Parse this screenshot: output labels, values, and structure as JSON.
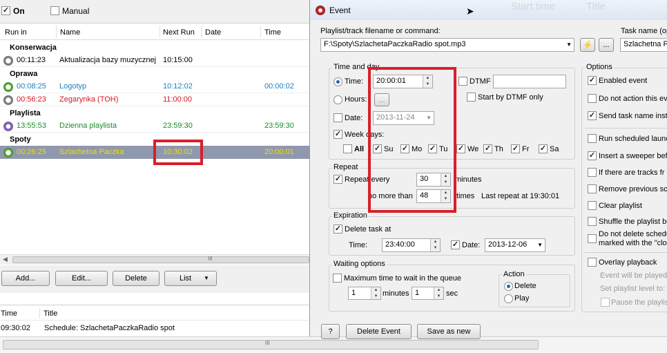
{
  "left": {
    "on_label": "On",
    "manual_label": "Manual",
    "columns": [
      "Run in",
      "Name",
      "Next Run",
      "Date",
      "Time"
    ],
    "groups": [
      {
        "name": "Konserwacja",
        "rows": [
          {
            "runin": "00:11:23",
            "name": "Aktualizacja bazy muzycznej",
            "next": "10:15:00",
            "date": "",
            "time": "",
            "color": "#000000"
          }
        ]
      },
      {
        "name": "Oprawa",
        "rows": [
          {
            "runin": "00:08:25",
            "name": "Logotyp",
            "next": "10:12:02",
            "date": "",
            "time": "00:00:02",
            "color": "#1a7fc0"
          },
          {
            "runin": "00:56:23",
            "name": "Zegarynka (TOH)",
            "next": "11:00:00",
            "date": "",
            "time": "",
            "color": "#d4161f"
          }
        ]
      },
      {
        "name": "Playlista",
        "rows": [
          {
            "runin": "13:55:53",
            "name": "Dzienna playlista",
            "next": "23:59:30",
            "date": "",
            "time": "23:59:30",
            "color": "#1a8a2a"
          }
        ]
      },
      {
        "name": "Spoty",
        "rows": [
          {
            "runin": "00:26:25",
            "name": "Szlachetna Paczka",
            "next": "10:30:02",
            "date": "",
            "time": "20:00:01",
            "color": "#f0e000",
            "selected": true
          }
        ]
      }
    ],
    "scroll_grip": "III",
    "buttons": {
      "add": "Add...",
      "edit": "Edit...",
      "delete": "Delete",
      "list": "List"
    },
    "log": {
      "columns": [
        "Time",
        "Title"
      ],
      "rows": [
        {
          "time": "09:30:02",
          "title": "Schedule: SzlachetaPaczkaRadio spot"
        }
      ]
    },
    "bottom_grip": "III"
  },
  "dialog": {
    "title": "Event",
    "bg_fragments": [
      "Start time",
      "Title"
    ],
    "playlist_label": "Playlist/track filename or command:",
    "playlist_value": "F:\\Spoty\\SzlachetaPaczkaRadio spot.mp3",
    "browse_label": "...",
    "taskname_label": "Task name (op",
    "taskname_value": "Szlachetna Pa",
    "time_and_day": {
      "title": "Time and day",
      "time_label": "Time:",
      "time_value": "20:00:01",
      "dtmf_label": "DTMF",
      "hours_label": "Hours:",
      "hours_button": "...",
      "start_dtmf_label": "Start by DTMF only",
      "date_label": "Date:",
      "date_value": "2013-11-24",
      "weekdays_label": "Week days:",
      "all_label": "All",
      "days": [
        "Su",
        "Mo",
        "Tu",
        "We",
        "Th",
        "Fr",
        "Sa"
      ]
    },
    "repeat": {
      "title": "Repeat",
      "every_label": "Repeat every",
      "every_value": "30",
      "minutes_label": "minutes",
      "nomore_label": "no more than",
      "nomore_value": "48",
      "times_label": "times",
      "last_repeat": "Last repeat at 19:30:01"
    },
    "expiration": {
      "title": "Expiration",
      "delete_label": "Delete task at",
      "time_label": "Time:",
      "time_value": "23:40:00",
      "date_label": "Date:",
      "date_value": "2013-12-06"
    },
    "waiting": {
      "title": "Waiting options",
      "max_label": "Maximum time to wait in the queue",
      "min_value": "1",
      "minutes_label": "minutes",
      "sec_value": "1",
      "sec_label": "sec",
      "action_title": "Action",
      "delete_label": "Delete",
      "play_label": "Play"
    },
    "options": {
      "title": "Options",
      "items": [
        {
          "label": "Enabled event",
          "checked": true
        },
        {
          "label": "Do not action this eve",
          "checked": false
        },
        {
          "label": "Send task name inste",
          "checked": true
        },
        {
          "label": "Run scheduled launch",
          "checked": false
        },
        {
          "label": "Insert a sweeper bef",
          "checked": true
        },
        {
          "label": "If there are tracks fr",
          "checked": false
        },
        {
          "label": "Remove previous sch",
          "checked": false
        },
        {
          "label": "Clear playlist",
          "checked": false
        },
        {
          "label": "Shuffle the playlist be",
          "checked": false
        },
        {
          "label": "Do not delete schedu",
          "label2": "marked with the \"cloc",
          "checked": false
        },
        {
          "label": "Overlay playback",
          "checked": false
        }
      ],
      "played_label": "Event will be played",
      "level_label": "Set playlist level to:",
      "pause_label": "Pause the playlis"
    },
    "buttons": {
      "help": "?",
      "delete_event": "Delete Event",
      "save_new": "Save as new"
    }
  },
  "colors": {
    "highlight": "#d81f2a",
    "selection": "#8f98ad",
    "accent": "#2a5fb3"
  }
}
